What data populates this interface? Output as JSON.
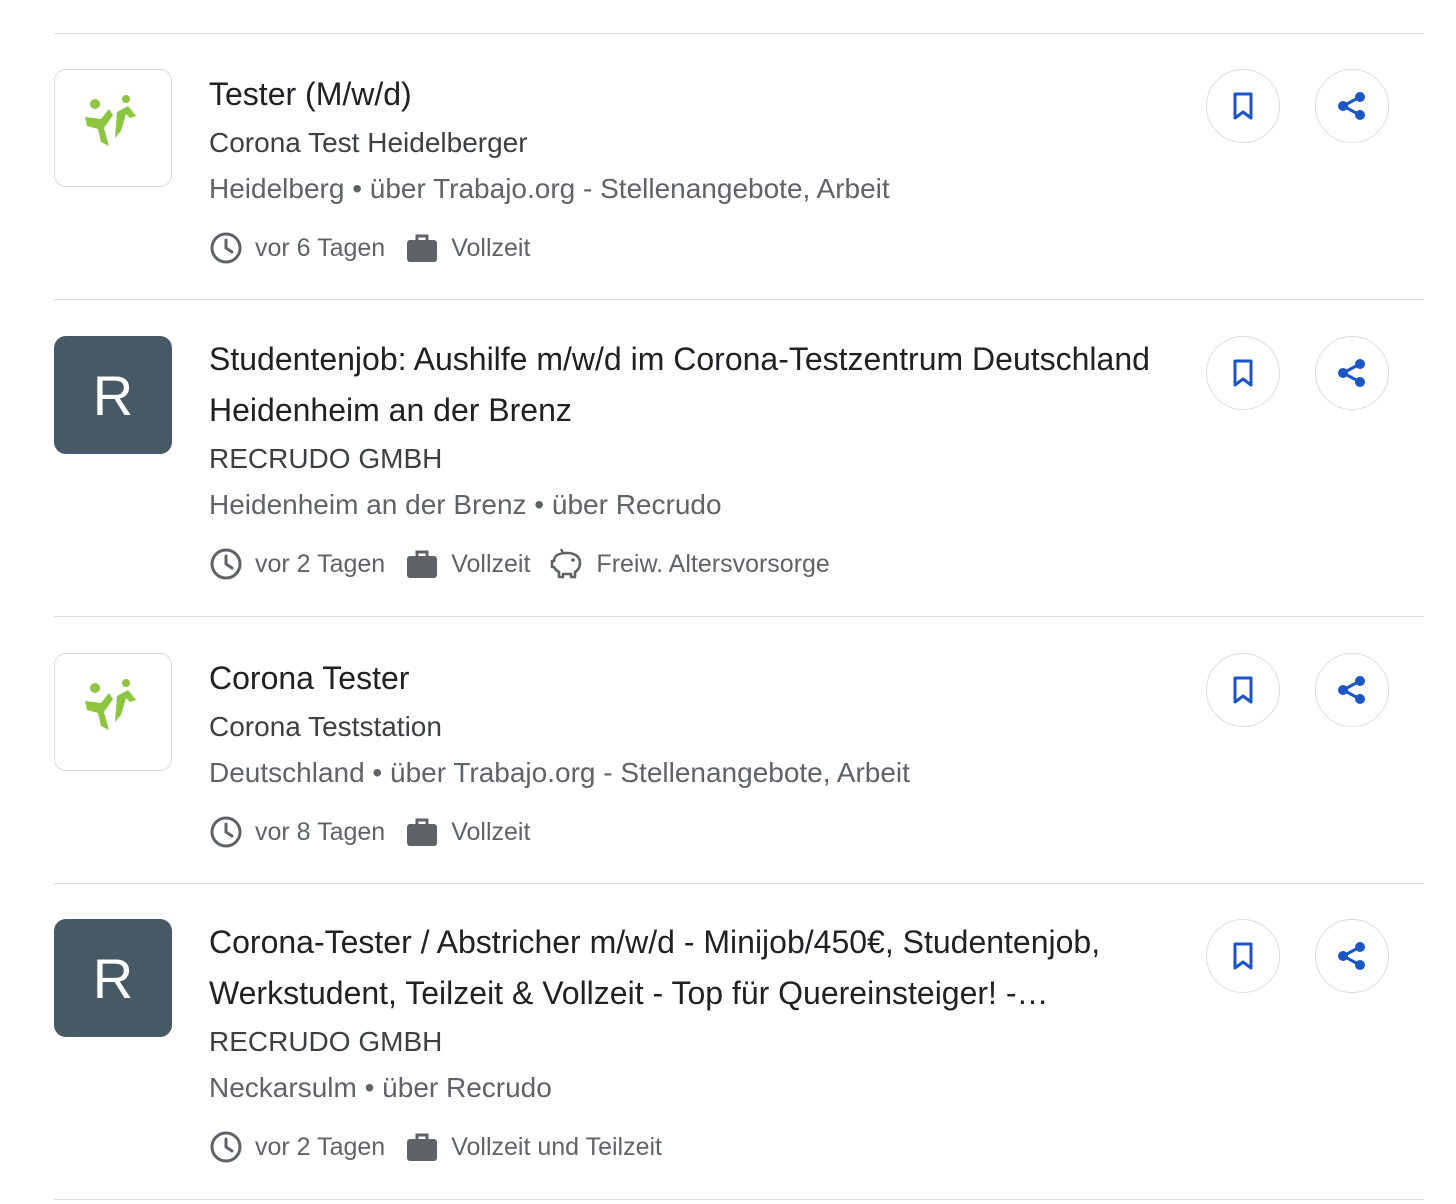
{
  "jobs": [
    {
      "title": "Tester (M/w/d)",
      "company": "Corona Test Heidelberger",
      "source": "Heidelberg • über Trabajo.org - Stellenangebote, Arbeit",
      "posted": "vor 6 Tagen",
      "type": "Vollzeit"
    },
    {
      "title": "Studentenjob: Aushilfe m/w/d im Corona-Testzentrum Deutschland Heidenheim an der Brenz",
      "logo_letter": "R",
      "company": "RECRUDO GMBH",
      "source": "Heidenheim an der Brenz • über Recrudo",
      "posted": "vor 2 Tagen",
      "type": "Vollzeit",
      "benefit": "Freiw. Altersvorsorge"
    },
    {
      "title": "Corona Tester",
      "company": "Corona Teststation",
      "source": "Deutschland • über Trabajo.org - Stellenangebote, Arbeit",
      "posted": "vor 8 Tagen",
      "type": "Vollzeit"
    },
    {
      "title": "Corona-Tester / Abstricher m/w/d - Minijob/450€, Studentenjob, Werkstudent, Teilzeit & Vollzeit - Top für Quereinsteiger! -…",
      "logo_letter": "R",
      "company": "RECRUDO GMBH",
      "source": "Neckarsulm • über Recrudo",
      "posted": "vor 2 Tagen",
      "type": "Vollzeit und Teilzeit"
    }
  ],
  "icons": {
    "posted": "clock-icon",
    "type": "briefcase-icon",
    "benefit": "piggy-bank-icon",
    "save": "bookmark-icon",
    "share": "share-icon"
  },
  "colors": {
    "action_blue": "#1a56c8",
    "logo_letter_bg": "#455a64",
    "logo_green": "#8cc63f"
  }
}
